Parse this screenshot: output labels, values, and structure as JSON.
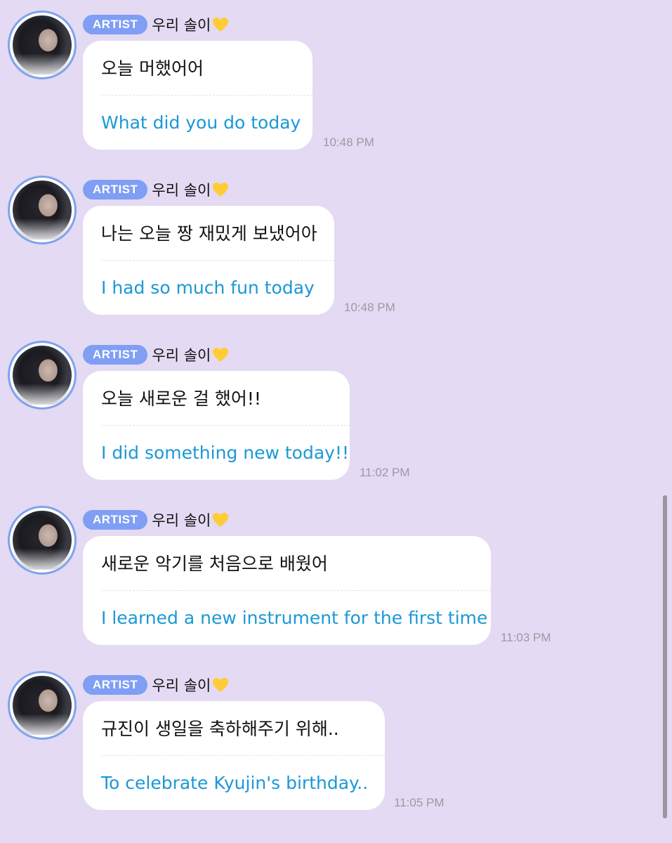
{
  "messages": [
    {
      "badge": "ARTIST",
      "sender": "우리 솔이",
      "korean": "오늘 머했어어",
      "english": "What did you do today",
      "time": "10:48 PM"
    },
    {
      "badge": "ARTIST",
      "sender": "우리 솔이",
      "korean": "나는 오늘 짱 재밌게 보냈어아",
      "english": "I had so much fun today",
      "time": "10:48 PM"
    },
    {
      "badge": "ARTIST",
      "sender": "우리 솔이",
      "korean": "오늘 새로운 걸 했어!!",
      "english": "I did something new today!!",
      "time": "11:02 PM"
    },
    {
      "badge": "ARTIST",
      "sender": "우리 솔이",
      "korean": "새로운 악기를 처음으로 배웠어",
      "english": "I learned a new instrument for the first time",
      "time": "11:03 PM"
    },
    {
      "badge": "ARTIST",
      "sender": "우리 솔이",
      "korean": "규진이 생일을 축하해주기 위해..",
      "english": "To celebrate Kyujin's birthday..",
      "time": "11:05 PM"
    }
  ],
  "icons": {
    "avatar": "profile-photo",
    "heart": "yellow-heart-icon"
  },
  "colors": {
    "background": "#e4daf3",
    "badge": "#7f9ef4",
    "translation_text": "#1b98d6",
    "heart": "#ffcc33",
    "avatar_ring": "#7ea3ec"
  }
}
